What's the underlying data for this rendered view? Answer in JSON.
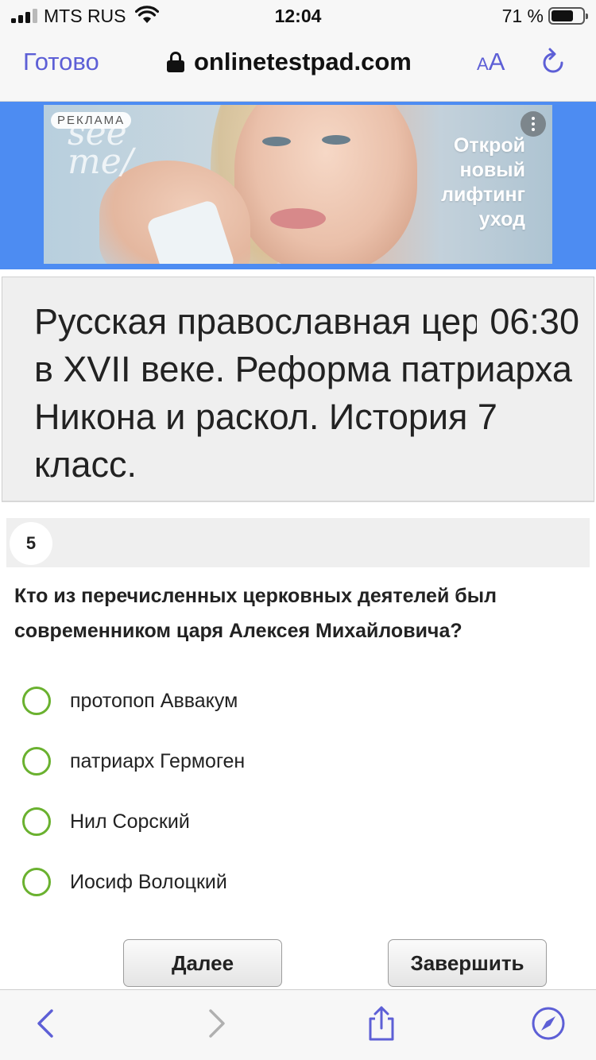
{
  "status_bar": {
    "carrier": "MTS RUS",
    "time": "12:04",
    "battery_percent": "71 %",
    "battery_level": 0.71,
    "signal_bars": 3
  },
  "browser": {
    "done_label": "Готово",
    "url": "onlinetestpad.com",
    "text_size_small": "A",
    "text_size_big": "A",
    "accent_color": "#5d5fd6"
  },
  "ad": {
    "label": "РЕКЛАМА",
    "logo": "see\nme/",
    "text": "Открой\nновый\nлифтинг\nуход",
    "band_color": "#4d8cf2"
  },
  "test": {
    "title": "Русская православная церковь в XVII веке. Реформа патриарха Никона и раскол. История 7 класс.",
    "timer": "06:30"
  },
  "question": {
    "number": "5",
    "text": "Кто из перечисленных церковных деятелей был современником царя Алексея Михайловича?",
    "options": [
      {
        "label": "протопоп Аввакум"
      },
      {
        "label": "патриарх Гермоген"
      },
      {
        "label": "Нил Сорский"
      },
      {
        "label": "Иосиф Волоцкий"
      }
    ],
    "radio_color": "#6ab12f"
  },
  "actions": {
    "next_label": "Далее",
    "finish_label": "Завершить"
  },
  "toolbar": {
    "icons": [
      "back-icon",
      "forward-icon",
      "share-icon",
      "safari-compass-icon"
    ]
  }
}
